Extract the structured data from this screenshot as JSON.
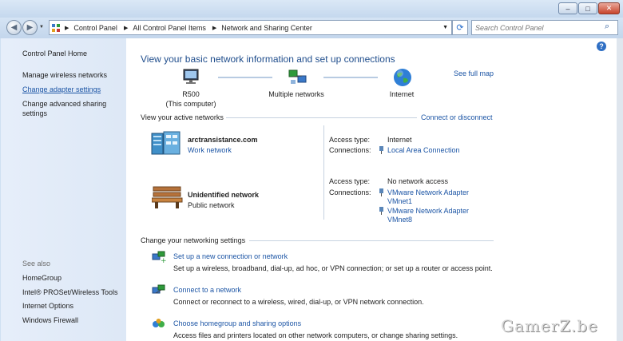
{
  "window": {
    "minimize_glyph": "–",
    "maximize_glyph": "□",
    "close_glyph": "✕"
  },
  "address": {
    "crumbs": [
      "Control Panel",
      "All Control Panel Items",
      "Network and Sharing Center"
    ],
    "search_placeholder": "Search Control Panel"
  },
  "sidebar": {
    "home": "Control Panel Home",
    "items": [
      "Manage wireless networks",
      "Change adapter settings",
      "Change advanced sharing settings"
    ],
    "see_also_label": "See also",
    "see_also": [
      "HomeGroup",
      "Intel® PROSet/Wireless Tools",
      "Internet Options",
      "Windows Firewall"
    ]
  },
  "main": {
    "title": "View your basic network information and set up connections",
    "see_full_map": "See full map",
    "map": {
      "computer_name": "R500",
      "computer_sub": "(This computer)",
      "middle": "Multiple networks",
      "internet": "Internet"
    },
    "active_header": "View your active networks",
    "connect_disconnect": "Connect or disconnect",
    "networks": [
      {
        "name": "arctransistance.com",
        "type": "Work network",
        "access_label": "Access type:",
        "access_value": "Internet",
        "connections_label": "Connections:",
        "connections": [
          "Local Area Connection"
        ]
      },
      {
        "name": "Unidentified network",
        "type": "Public network",
        "access_label": "Access type:",
        "access_value": "No network access",
        "connections_label": "Connections:",
        "connections": [
          "VMware Network Adapter VMnet1",
          "VMware Network Adapter VMnet8"
        ]
      }
    ],
    "change_header": "Change your networking settings",
    "tasks": [
      {
        "title": "Set up a new connection or network",
        "desc": "Set up a wireless, broadband, dial-up, ad hoc, or VPN connection; or set up a router or access point."
      },
      {
        "title": "Connect to a network",
        "desc": "Connect or reconnect to a wireless, wired, dial-up, or VPN network connection."
      },
      {
        "title": "Choose homegroup and sharing options",
        "desc": "Access files and printers located on other network computers, or change sharing settings."
      }
    ],
    "help_glyph": "?"
  },
  "watermark": "GamerZ.be"
}
